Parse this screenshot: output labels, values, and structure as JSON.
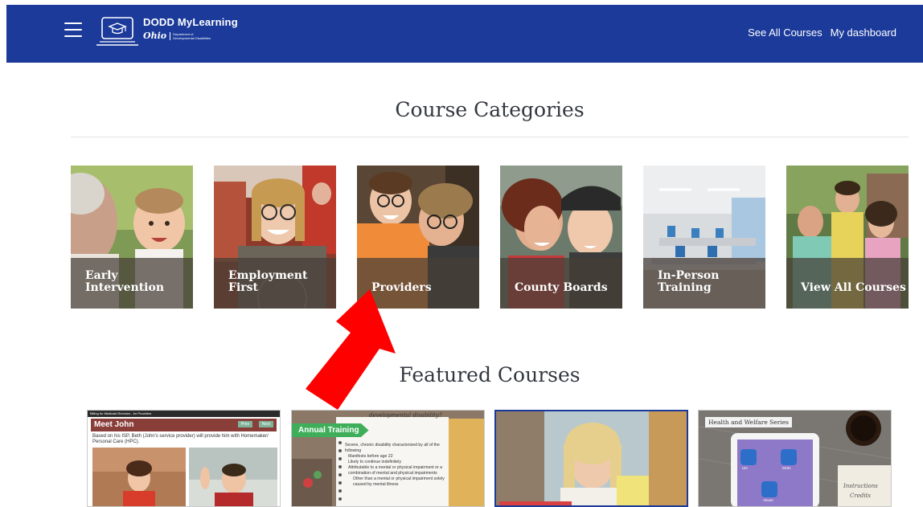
{
  "header": {
    "logo_title": "DODD MyLearning",
    "logo_state": "Ohio",
    "logo_dept_line1": "Department of",
    "logo_dept_line2": "Developmental Disabilities",
    "links": [
      "See All Courses",
      "My dashboard"
    ],
    "bg_color": "#1b3a9a"
  },
  "categories": {
    "title": "Course Categories",
    "items": [
      {
        "line1": "Early",
        "line2": "Intervention"
      },
      {
        "line1": "Employment",
        "line2": "First"
      },
      {
        "line1": "",
        "line2": "Providers"
      },
      {
        "line1": "",
        "line2": "County Boards"
      },
      {
        "line1": "In-Person",
        "line2": "Training"
      },
      {
        "line1": "",
        "line2": "View All Courses"
      }
    ]
  },
  "featured": {
    "title": "Featured Courses",
    "card1": {
      "topbar": "Billing for Medicaid Services - for Providers",
      "heading": "Meet John",
      "prev": "Prev",
      "next": "Next",
      "body": "Based on his ISP, Beth (John's service provider) will provide him with Homemaker/ Personal Care (HPC)."
    },
    "card2": {
      "badge": "Annual Training",
      "note_title": "developmental disability?",
      "note_intro": "Severe, chronic disability characterized by all of the following",
      "bullets": [
        "Manifests before age 22",
        "Likely to continue indefinitely",
        "Attributable to a mental or physical impairment or a combination of mental and physical impairments",
        "Other than a mental or physical impairment solely caused by mental illness"
      ]
    },
    "card4": {
      "series": "Health and Welfare Series",
      "app_labels": [
        "UIs",
        "MUIs",
        "Abuse"
      ],
      "side_note": "Instructions",
      "side_note2": "Credits"
    }
  },
  "annotation": {
    "arrow_color": "#ff0000"
  }
}
